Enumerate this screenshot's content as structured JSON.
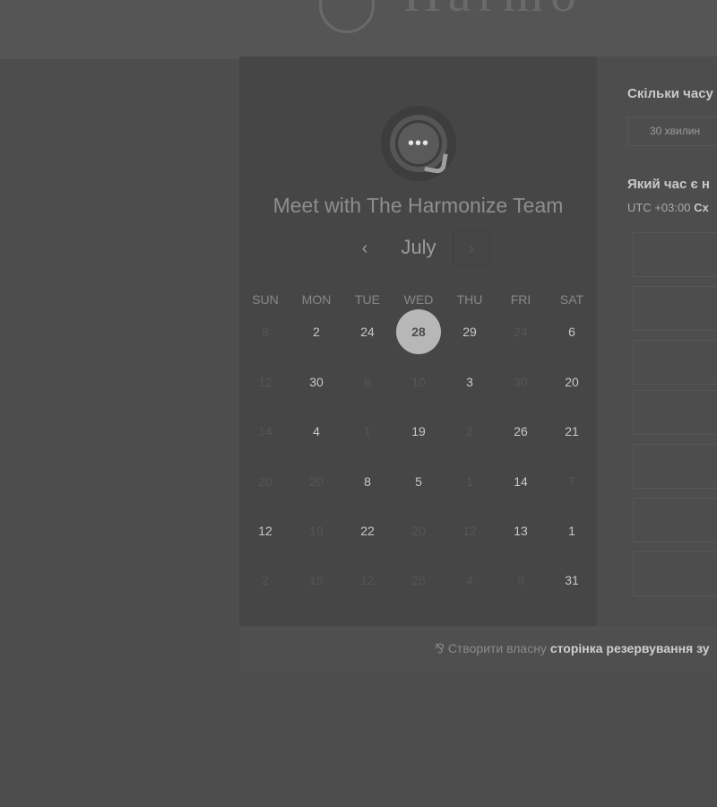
{
  "header": {
    "logo_text": "Harmo"
  },
  "booking": {
    "meeting_title": "Meet with The Harmonize Team",
    "month": "July",
    "prev_symbol": "‹",
    "next_symbol": "›",
    "weekdays": [
      "SUN",
      "MON",
      "TUE",
      "WED",
      "THU",
      "FRI",
      "SAT"
    ],
    "weeks": [
      [
        {
          "d": "8",
          "a": false
        },
        {
          "d": "2",
          "a": true
        },
        {
          "d": "24",
          "a": true
        },
        {
          "d": "28",
          "a": true,
          "selected": true
        },
        {
          "d": "29",
          "a": true
        },
        {
          "d": "24",
          "a": false
        },
        {
          "d": "6",
          "a": true
        }
      ],
      [
        {
          "d": "12",
          "a": false
        },
        {
          "d": "30",
          "a": true
        },
        {
          "d": "8",
          "a": false
        },
        {
          "d": "10",
          "a": false
        },
        {
          "d": "3",
          "a": true
        },
        {
          "d": "30",
          "a": false
        },
        {
          "d": "20",
          "a": true
        }
      ],
      [
        {
          "d": "14",
          "a": false
        },
        {
          "d": "4",
          "a": true
        },
        {
          "d": "1",
          "a": false
        },
        {
          "d": "19",
          "a": true
        },
        {
          "d": "2",
          "a": false
        },
        {
          "d": "26",
          "a": true
        },
        {
          "d": "21",
          "a": true
        }
      ],
      [
        {
          "d": "20",
          "a": false
        },
        {
          "d": "20",
          "a": false
        },
        {
          "d": "8",
          "a": true
        },
        {
          "d": "5",
          "a": true
        },
        {
          "d": "1",
          "a": false
        },
        {
          "d": "14",
          "a": true
        },
        {
          "d": "7",
          "a": false
        }
      ],
      [
        {
          "d": "12",
          "a": true
        },
        {
          "d": "19",
          "a": false
        },
        {
          "d": "22",
          "a": true
        },
        {
          "d": "20",
          "a": false
        },
        {
          "d": "12",
          "a": false
        },
        {
          "d": "13",
          "a": true
        },
        {
          "d": "1",
          "a": true
        }
      ],
      [
        {
          "d": "2",
          "a": false
        },
        {
          "d": "15",
          "a": false
        },
        {
          "d": "12",
          "a": false
        },
        {
          "d": "26",
          "a": false
        },
        {
          "d": "4",
          "a": false
        },
        {
          "d": "9",
          "a": false
        },
        {
          "d": "31",
          "a": true
        }
      ]
    ]
  },
  "right_panel": {
    "duration_question": "Скільки часу",
    "duration_value": "30 хвилин",
    "time_question": "Який час є н",
    "timezone_prefix": "UTC +03:00",
    "timezone_name": "Сх",
    "slot_count": 7
  },
  "footer": {
    "icon": "harmonize-sprout-icon",
    "text": "Створити власну",
    "bold_text": "сторінка резервування зу"
  }
}
